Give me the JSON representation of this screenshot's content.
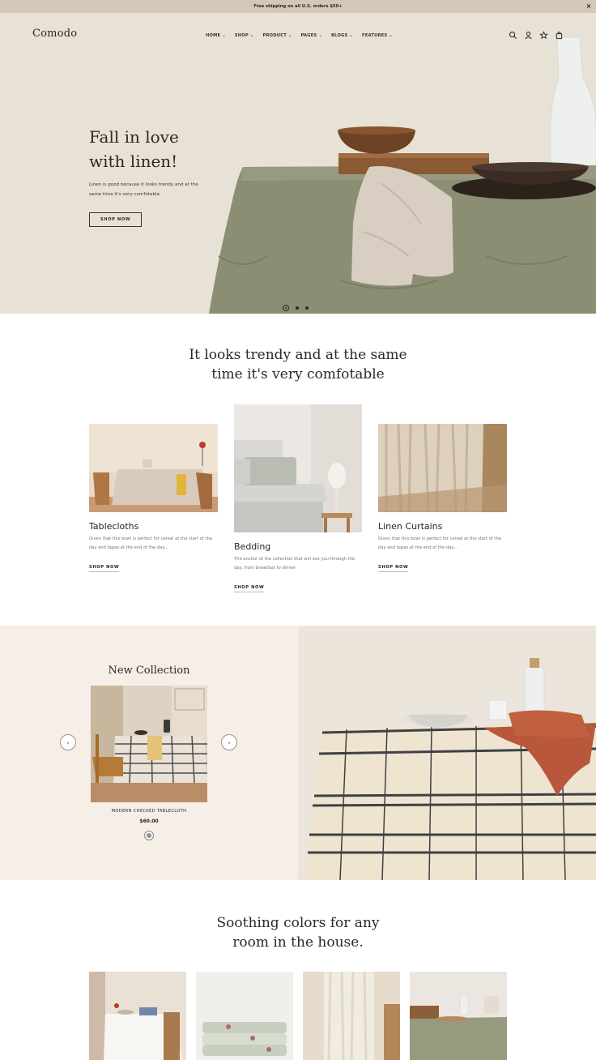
{
  "announcement": {
    "text": "Free shipping on all U.S. orders $50+",
    "close_icon": "×"
  },
  "header": {
    "logo": "Comodo",
    "nav": [
      {
        "label": "HOME",
        "caret": "⌄"
      },
      {
        "label": "SHOP",
        "caret": "⌄"
      },
      {
        "label": "PRODUCT",
        "caret": "⌄"
      },
      {
        "label": "PAGES",
        "caret": "⌄"
      },
      {
        "label": "BLOGS",
        "caret": "⌄"
      },
      {
        "label": "FEATURES",
        "caret": "⌄"
      }
    ],
    "icons": [
      "search-icon",
      "account-icon",
      "wishlist-icon",
      "cart-icon"
    ]
  },
  "hero": {
    "title_line1": "Fall in love",
    "title_line2": "with linen!",
    "subtitle_line1": "Linen is good because it looks trendy and at the",
    "subtitle_line2": "same time it's very comfotable",
    "button": "SHOP NOW",
    "slides": 3,
    "active_slide": 1
  },
  "categories": {
    "heading_line1": "It looks trendy and at the same",
    "heading_line2": "time it's very comfotable",
    "items": [
      {
        "title": "Tablecloths",
        "desc_line1": "Given that this bowl is perfect for cereal at the start of the",
        "desc_line2": "day and tapas at the end of the day...",
        "link": "SHOP NOW"
      },
      {
        "title": "Bedding",
        "desc_line1": "The anchor of the collection that will see you through the",
        "desc_line2": "day, from breakfast to dinner",
        "link": "SHOP NOW"
      },
      {
        "title": "Linen Curtains",
        "desc_line1": "Given that this bowl is perfect for cereal at the start of the",
        "desc_line2": "day and tapas at the end of the day...",
        "link": "SHOP NOW"
      }
    ]
  },
  "collection": {
    "heading": "New Collection",
    "product_name": "MODERN CHECKED TABLECLOTH",
    "price": "$60.00",
    "prev_icon": "‹",
    "next_icon": "›"
  },
  "soothing": {
    "heading_line1": "Soothing colors for any",
    "heading_line2": "room in the house."
  },
  "colors": {
    "topbar": "#d5c7b8",
    "hero_bg": "#e6e0d5",
    "collection_bg": "#f6efe7",
    "linen_green": "#8a8e74"
  }
}
